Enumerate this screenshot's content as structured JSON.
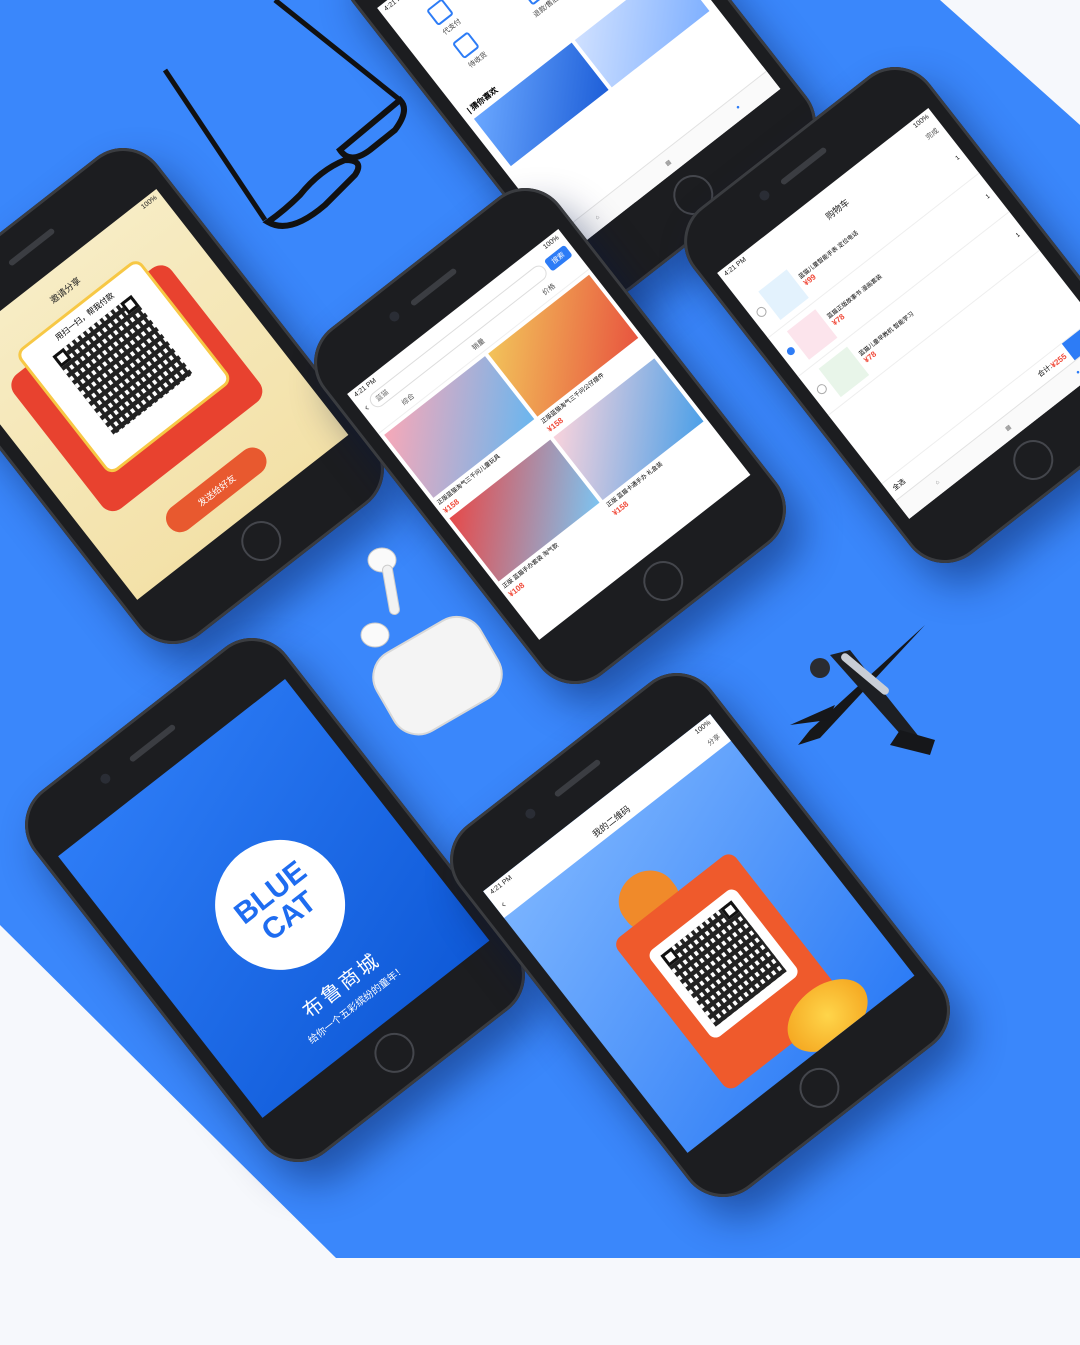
{
  "background": {
    "page": "#f6f8fc",
    "band": "#3a87fb"
  },
  "status": {
    "time": "4:21 PM",
    "carrier": "100%"
  },
  "phone_top": {
    "grid": [
      "代支付",
      "",
      "",
      "待收货",
      "退款/售后",
      ""
    ],
    "section_title": "| 猜你喜欢",
    "tabs": [
      "",
      "",
      ""
    ]
  },
  "phone_share": {
    "nav_title": "邀请分享",
    "headline": "用扫一扫，帮我付款",
    "button": "发送给好友"
  },
  "phone_list": {
    "search_placeholder": "蓝猫",
    "search_button": "搜索",
    "filters": [
      "综合",
      "销量",
      "价格"
    ],
    "products": [
      {
        "title": "正版蓝猫淘气三千问儿童玩具",
        "price": "¥158"
      },
      {
        "title": "正版蓝猫淘气三千问公仔摆件",
        "price": "¥158"
      },
      {
        "title": "正版 蓝猫手办套装 淘气款",
        "price": "¥108"
      },
      {
        "title": "正版 蓝猫卡通手办 礼盒装",
        "price": "¥158"
      }
    ]
  },
  "phone_cart": {
    "nav_title": "购物车",
    "edit": "完成",
    "items": [
      {
        "title": "蓝猫儿童智能手表 定位电话",
        "price": "¥99",
        "qty": "1"
      },
      {
        "title": "蓝猫正版故事书 漫画套装",
        "price": "¥78",
        "qty": "1"
      },
      {
        "title": "蓝猫儿童早教机 智能学习",
        "price": "¥78",
        "qty": "1"
      }
    ],
    "select_all": "全选",
    "total_label": "合计:",
    "total": "¥255"
  },
  "phone_splash": {
    "logo_line1": "BLUE",
    "logo_line2": "CAT",
    "title": "布鲁商城",
    "subtitle": "给你一个五彩缤纷的童年！"
  },
  "phone_qr": {
    "nav_title": "我的二维码",
    "nav_right": "分享"
  }
}
